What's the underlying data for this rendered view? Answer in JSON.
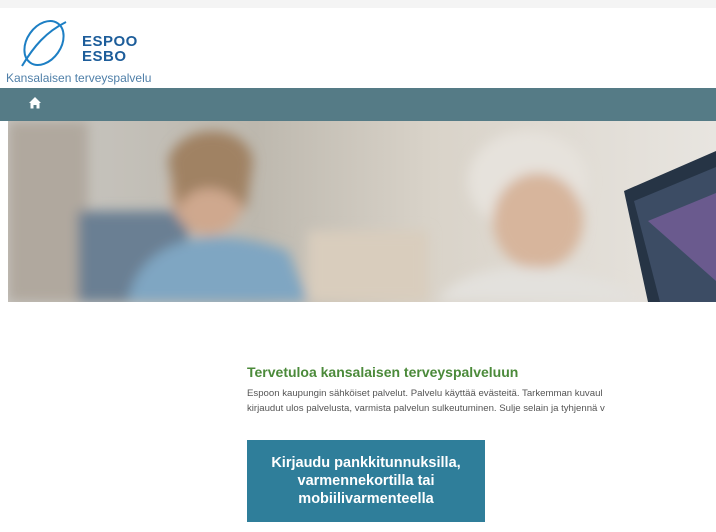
{
  "header": {
    "logo_line1": "ESPOO",
    "logo_line2": "ESBO",
    "subtitle": "Kansalaisen terveyspalvelu"
  },
  "nav": {
    "home_icon": "home-icon"
  },
  "main": {
    "welcome_title": "Tervetuloa kansalaisen terveyspalveluun",
    "intro_line1": "Espoon kaupungin sähköiset palvelut. Palvelu käyttää evästeitä. Tarkemman kuvaul",
    "intro_line2": "kirjaudut ulos palvelusta, varmista palvelun sulkeutuminen. Sulje selain ja tyhjennä v",
    "login_button": "Kirjaudu pankkitunnuksilla, varmennekortilla tai mobiilivarmenteella"
  },
  "colors": {
    "navbar": "#557b86",
    "welcome": "#4b8a3a",
    "button": "#2f7e9a",
    "logo": "#1d5d9a"
  }
}
